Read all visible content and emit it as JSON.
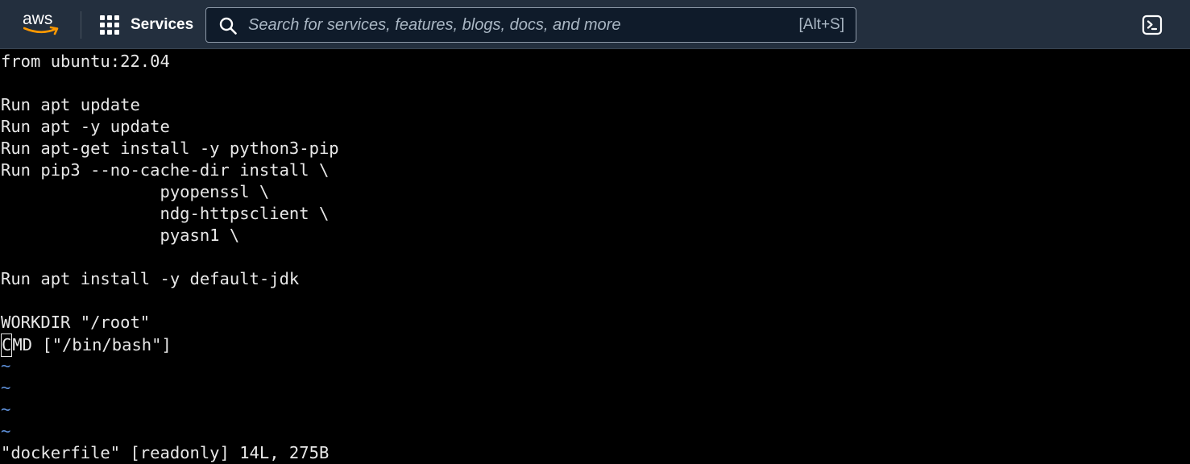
{
  "header": {
    "logo_text": "aws",
    "services_label": "Services",
    "search": {
      "placeholder": "Search for services, features, blogs, docs, and more",
      "value": "",
      "shortcut": "[Alt+S]"
    }
  },
  "icons": {
    "logo": "aws-logo",
    "services": "grid-icon",
    "search": "search-icon",
    "cloudshell": "cloudshell-icon"
  },
  "colors": {
    "header_bg": "#232f3e",
    "logo_smile": "#ff9900",
    "terminal_bg": "#000000",
    "terminal_text": "#e8e8e8",
    "tilde": "#5d8fd8"
  },
  "terminal": {
    "lines": [
      "from ubuntu:22.04",
      "",
      "Run apt update",
      "Run apt -y update",
      "Run apt-get install -y python3-pip",
      "Run pip3 --no-cache-dir install \\",
      "                pyopenssl \\",
      "                ndg-httpsclient \\",
      "                pyasn1 \\",
      "",
      "Run apt install -y default-jdk",
      "",
      "WORKDIR \"/root\"",
      "CMD [\"/bin/bash\"]"
    ],
    "cursor_char": "C",
    "cursor_rest": "MD [\"/bin/bash\"]",
    "tilde_lines": [
      "~",
      "~",
      "~",
      "~"
    ],
    "status": "\"dockerfile\" [readonly] 14L, 275B"
  }
}
